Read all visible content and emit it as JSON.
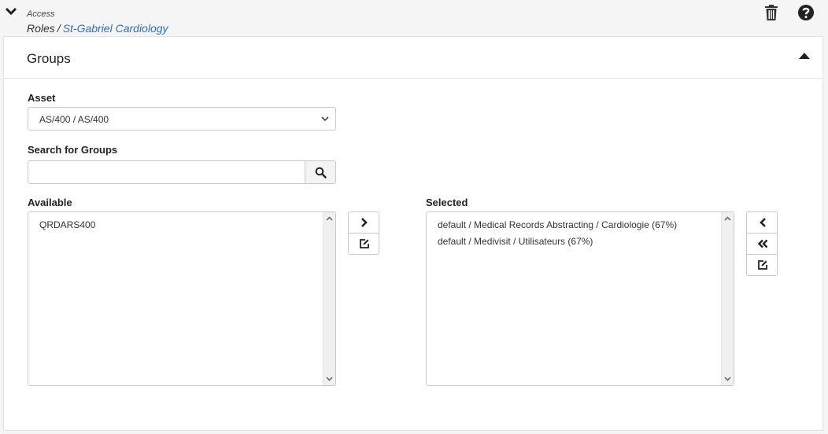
{
  "breadcrumb": {
    "section": "Access",
    "parent": "Roles",
    "separator": "/",
    "current": "St-Gabriel Cardiology"
  },
  "panel": {
    "title": "Groups"
  },
  "asset": {
    "label": "Asset",
    "selected": "AS/400 / AS/400"
  },
  "search": {
    "label": "Search for Groups",
    "value": "",
    "placeholder": ""
  },
  "available": {
    "label": "Available",
    "items": [
      "QRDARS400"
    ]
  },
  "selected": {
    "label": "Selected",
    "items": [
      "default / Medical Records Abstracting / Cardiologie (67%)",
      "default / Medivisit / Utilisateurs (67%)"
    ]
  },
  "icons": {
    "collapse": "chevron-down-icon",
    "trash": "trash-icon",
    "help": "help-icon",
    "panel_toggle": "caret-up-icon",
    "search": "search-icon",
    "add": "chevron-right-icon",
    "remove": "chevron-left-icon",
    "remove_all": "double-chevron-left-icon",
    "edit": "edit-icon"
  },
  "colors": {
    "link": "#2a6fb6",
    "background": "#f5f5f5",
    "panel": "#ffffff",
    "border": "#c9c9c9"
  }
}
